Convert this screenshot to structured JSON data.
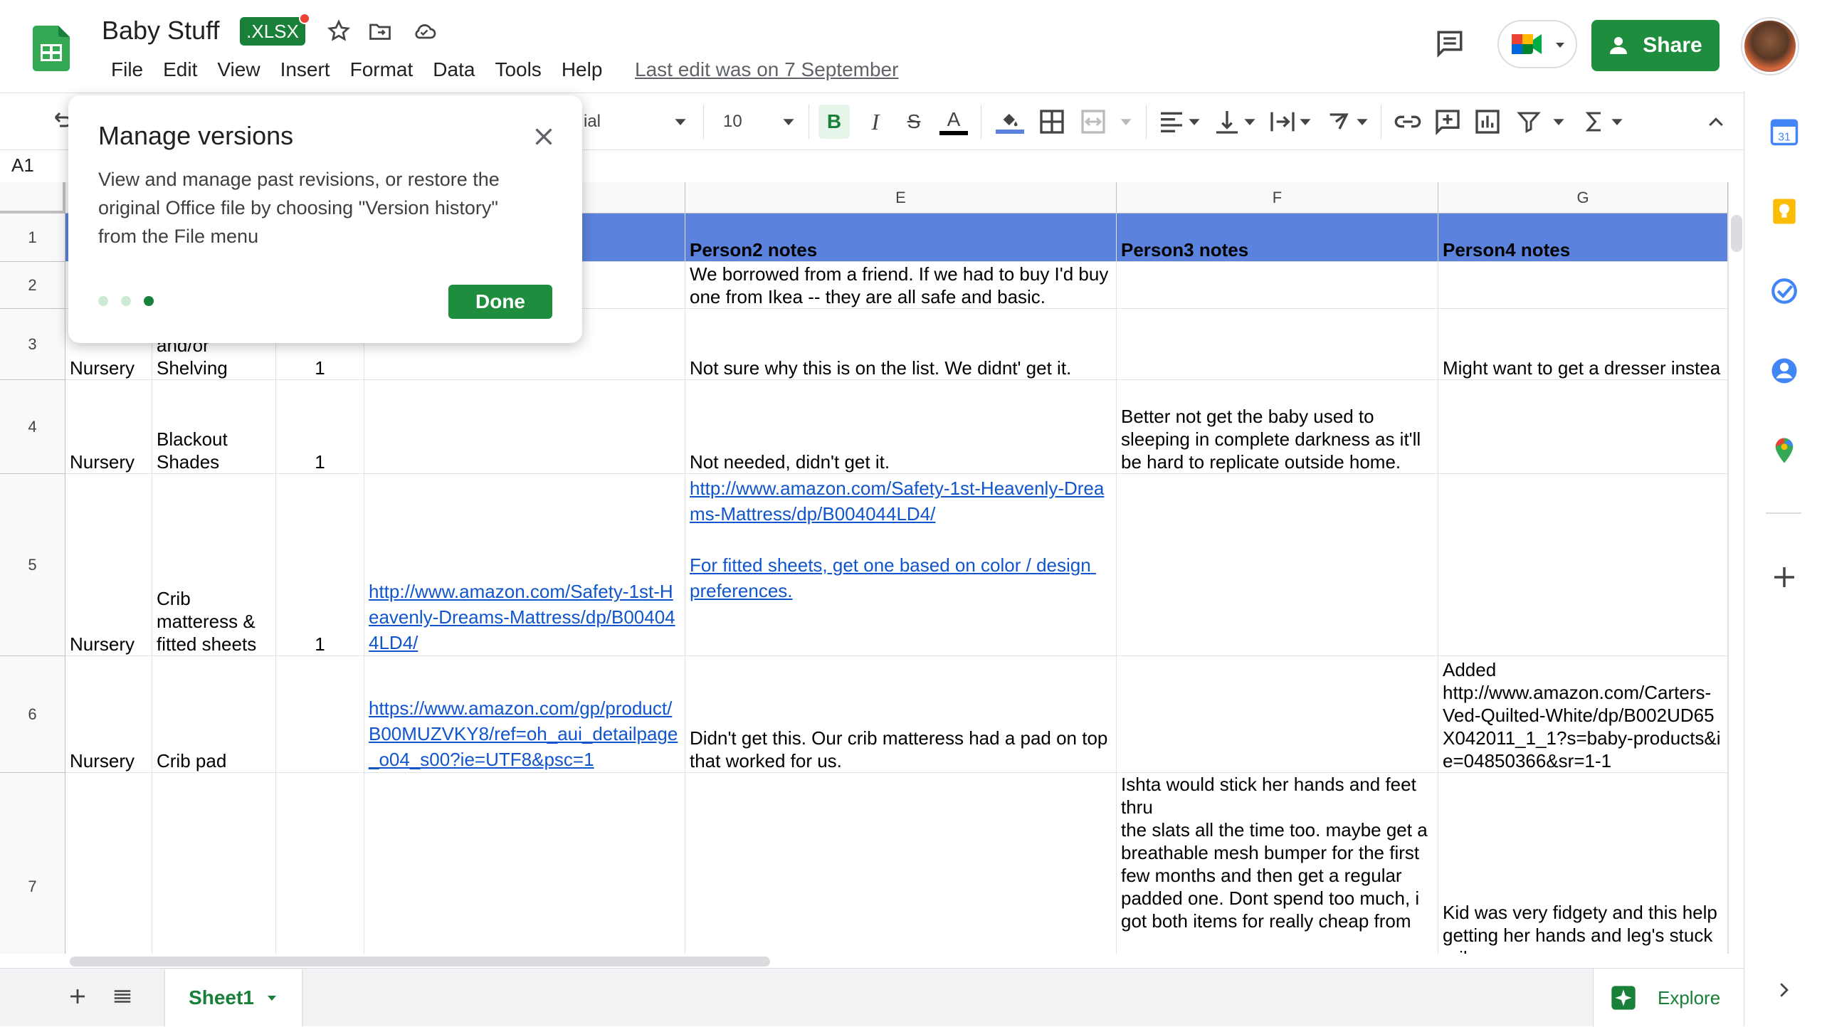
{
  "doc": {
    "title": "Baby Stuff",
    "format_badge": ".XLSX",
    "last_edit": "Last edit was on 7 September"
  },
  "menu": [
    "File",
    "Edit",
    "View",
    "Insert",
    "Format",
    "Data",
    "Tools",
    "Help"
  ],
  "header": {
    "share_label": "Share"
  },
  "toolbar": {
    "font_name": "ial",
    "font_size": "10",
    "bold": "B",
    "italic": "I",
    "strike": "S",
    "text_color": "A"
  },
  "formula_bar": {
    "name_box": "A1"
  },
  "popup": {
    "title": "Manage versions",
    "body": "View and manage past revisions, or restore the original Office file by choosing \"Version history\" from the File menu",
    "done_label": "Done"
  },
  "grid": {
    "columns": [
      "E",
      "F",
      "G"
    ],
    "rows": [
      "1",
      "2",
      "3",
      "4",
      "5",
      "6",
      "7"
    ],
    "header_cells": {
      "E": "Person2 notes",
      "F": "Person3 notes",
      "G": "Person4 notes"
    },
    "cells": {
      "A3": "Nursery",
      "B3": "and/or\nShelving",
      "C3": "1",
      "E3": "Not sure why this is on the list. We didnt' get it.",
      "G3": "Might want to get a dresser instea",
      "E2": "We borrowed from a friend. If we had to buy I'd buy one from Ikea -- they are all safe and basic.",
      "A4": "Nursery",
      "B4": "Blackout\nShades",
      "C4": "1",
      "E4": "Not needed, didn't get it.",
      "F4": "Better not get the baby used to sleeping in complete darkness as it'll be hard to replicate outside home.",
      "A5": "Nursery",
      "B5": "Crib\nmatteress &\nfitted sheets",
      "C5": "1",
      "D5": "http://www.amazon.com/Safety-1st-Heavenly-Dreams-Mattress/dp/B004044LD4/",
      "E5_link1": "http://www.amazon.com/Safety-1st-Heavenly-Dreams-Mattress/dp/B004044LD4/",
      "E5_link2": "For fitted sheets, get one based on color / design preferences.",
      "A6": "Nursery",
      "B6": "Crib pad",
      "D6": "https://www.amazon.com/gp/product/B00MUZVKY8/ref=oh_aui_detailpage_o04_s00?ie=UTF8&psc=1",
      "E6": "Didn't get this. Our crib matteress had a pad on top that worked for us.",
      "G6": "Added\nhttp://www.amazon.com/Carters-Ved-Quilted-White/dp/B002UD65X042011_1_1?s=baby-products&ie=04850366&sr=1-1",
      "F7": "Ishta would stick her hands and feet thru\nthe slats all the time too. maybe get a\nbreathable mesh bumper for the first few months and then get a regular padded one. Dont spend too much, i got both items for really cheap from",
      "G7": "Kid was very fidgety and this help getting her hands and leg's stuck rails"
    }
  },
  "sheets": [
    "Sheet1"
  ],
  "explore_label": "Explore",
  "colors": {
    "header_fill": "#5b83de",
    "accent_green": "#1e8e3e",
    "link": "#1155cc"
  }
}
